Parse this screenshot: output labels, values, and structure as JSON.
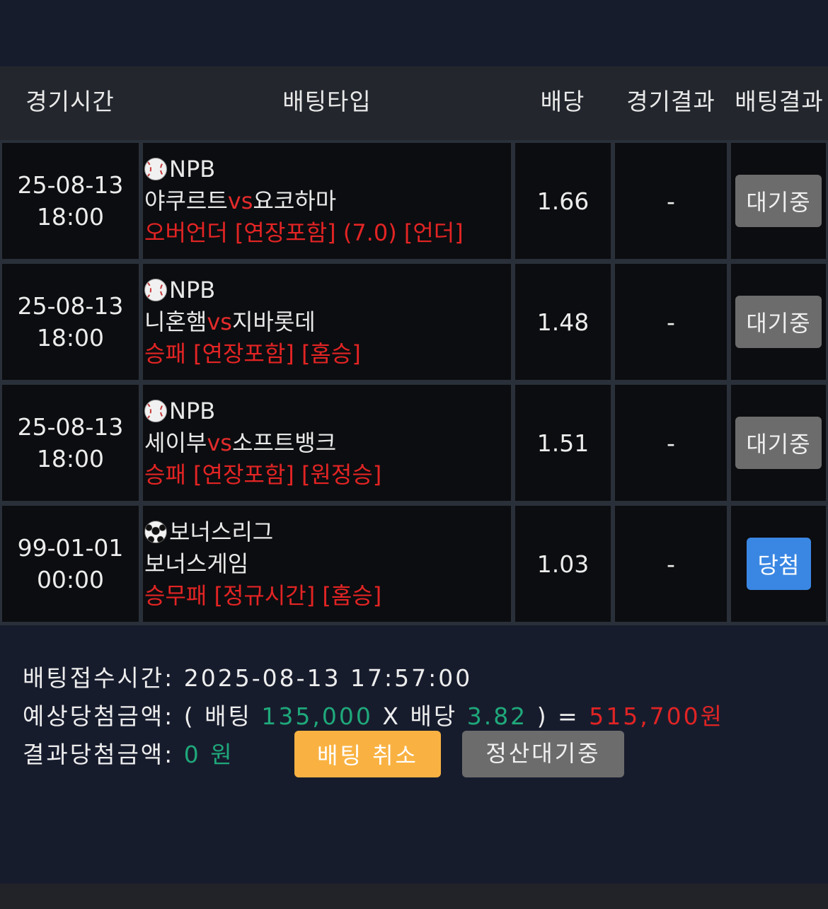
{
  "table": {
    "headers": [
      "경기시간",
      "배팅타입",
      "배당",
      "경기결과",
      "배팅결과"
    ],
    "rows": [
      {
        "date": "25-08-13",
        "time": "18:00",
        "sport_icon": "baseball-icon",
        "league": "NPB",
        "home": "야쿠르트",
        "vs": "vs",
        "away": "요코하마",
        "pick": "오버언더 [연장포함] (7.0) [언더]",
        "odds": "1.66",
        "result": "-",
        "status": "대기중",
        "status_type": "waiting"
      },
      {
        "date": "25-08-13",
        "time": "18:00",
        "sport_icon": "baseball-icon",
        "league": "NPB",
        "home": "니혼햄",
        "vs": "vs",
        "away": "지바롯데",
        "pick": "승패 [연장포함] [홈승]",
        "odds": "1.48",
        "result": "-",
        "status": "대기중",
        "status_type": "waiting"
      },
      {
        "date": "25-08-13",
        "time": "18:00",
        "sport_icon": "baseball-icon",
        "league": "NPB",
        "home": "세이부",
        "vs": "vs",
        "away": "소프트뱅크",
        "pick": "승패 [연장포함] [원정승]",
        "odds": "1.51",
        "result": "-",
        "status": "대기중",
        "status_type": "waiting"
      },
      {
        "date": "99-01-01",
        "time": "00:00",
        "sport_icon": "soccer-ball-icon",
        "league": "보너스리그",
        "match": "보너스게임",
        "pick": "승무패 [정규시간] [홈승]",
        "odds": "1.03",
        "result": "-",
        "status": "당첨",
        "status_type": "win"
      }
    ]
  },
  "summary": {
    "received_label": "배팅접수시간:",
    "received_value": "2025-08-13 17:57:00",
    "expected_label": "예상당첨금액:",
    "open_paren": "(",
    "bet_label": "배팅",
    "bet_amount": "135,000",
    "times": "X",
    "odds_label": "배당",
    "total_odds": "3.82",
    "close_eq": ") =",
    "expected_amount": "515,700원",
    "result_label": "결과당첨금액:",
    "result_amount": "0 원"
  },
  "buttons": {
    "cancel": "배팅 취소",
    "settle": "정산대기중"
  },
  "colors": {
    "background": "#171c2d",
    "accent_green": "#1fa87a",
    "accent_red": "#e02424",
    "cancel_button": "#f9b242",
    "win_button": "#3a87e3",
    "wait_button": "#6c6c6c"
  }
}
